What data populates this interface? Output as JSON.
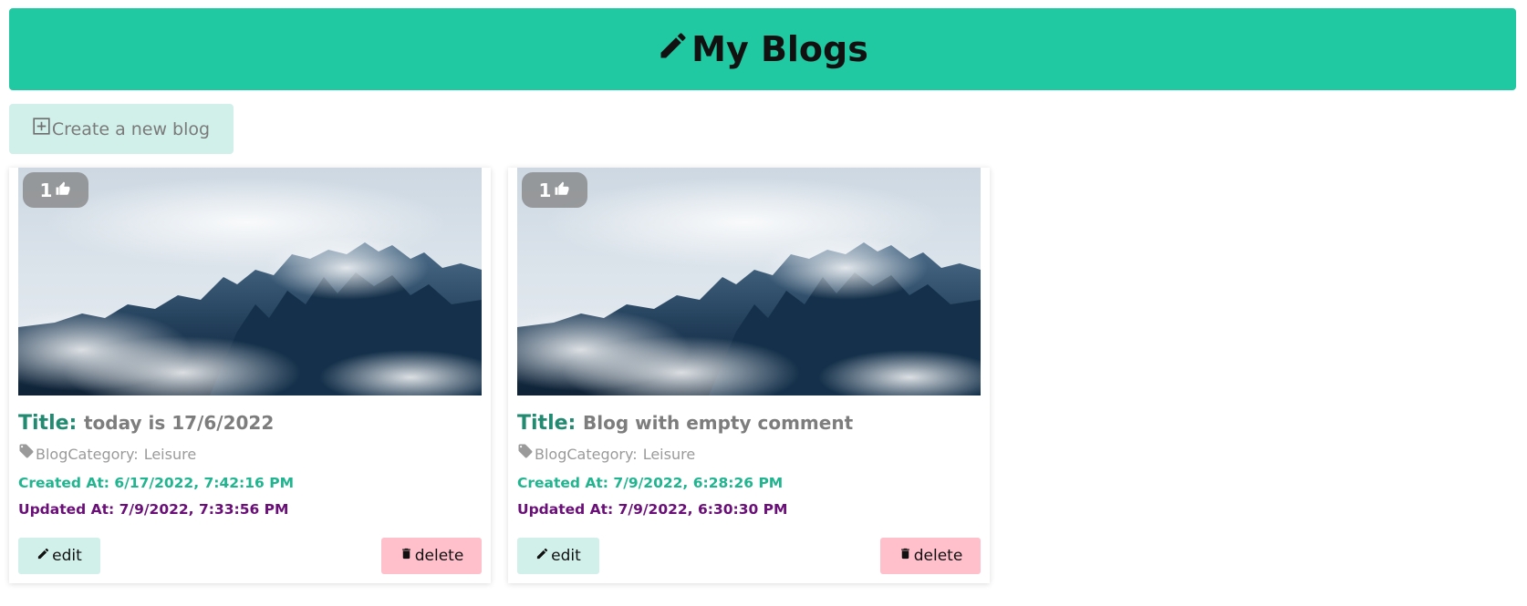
{
  "header": {
    "title": "My Blogs",
    "icon": "pencil-icon",
    "color": "#20c9a1"
  },
  "create_button": {
    "label": "Create a new blog",
    "icon": "plus-square-icon"
  },
  "blogs": [
    {
      "likes": "1",
      "title_label": "Title:",
      "title": "today is 17/6/2022",
      "category_label": "BlogCategory:",
      "category": "Leisure",
      "created": "Created At: 6/17/2022, 7:42:16 PM",
      "updated": "Updated At: 7/9/2022, 7:33:56 PM",
      "edit_label": "edit",
      "delete_label": "delete"
    },
    {
      "likes": "1",
      "title_label": "Title:",
      "title": "Blog with empty comment",
      "category_label": "BlogCategory:",
      "category": "Leisure",
      "created": "Created At: 7/9/2022, 6:28:26 PM",
      "updated": "Updated At: 7/9/2022, 6:30:30 PM",
      "edit_label": "edit",
      "delete_label": "delete"
    }
  ],
  "colors": {
    "accent": "#20c9a1",
    "title_label": "#218a71",
    "created": "#20b48f",
    "updated": "#6a0f78",
    "delete_bg": "#ffc0cb",
    "edit_bg": "#d2f0ea"
  }
}
